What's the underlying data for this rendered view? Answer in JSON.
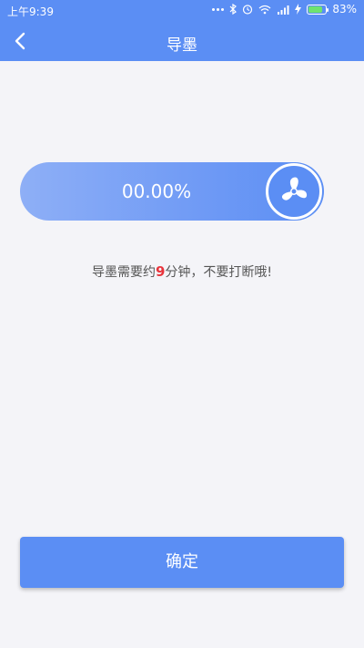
{
  "status_bar": {
    "time": "上午9:39",
    "battery_percent": "83%",
    "battery_level": 0.83,
    "icons": [
      "more-dots-icon",
      "bluetooth-icon",
      "alarm-icon",
      "wifi-icon",
      "signal-icon",
      "charging-icon",
      "battery-icon"
    ]
  },
  "navbar": {
    "title": "导墨",
    "back_icon": "chevron-left-icon"
  },
  "progress": {
    "text": "00.00%",
    "value": 0,
    "icon": "fan-icon"
  },
  "hint": {
    "prefix": "导墨需要约",
    "minutes": "9",
    "suffix": "分钟，不要打断哦!"
  },
  "footer": {
    "confirm_label": "确定"
  },
  "colors": {
    "primary": "#5b8ef4",
    "background": "#f4f4f8",
    "highlight": "#e8343c"
  }
}
